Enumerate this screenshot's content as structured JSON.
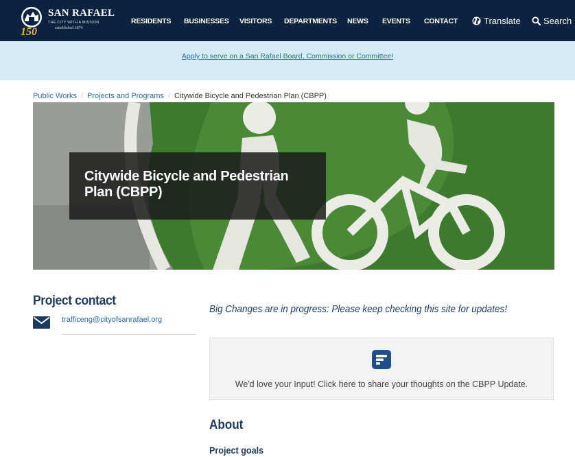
{
  "header": {
    "logo": {
      "name": "SAN RAFAEL",
      "tagline": "THE CITY WITH A MISSION",
      "established": "established 1874",
      "badge": "150"
    },
    "nav": [
      {
        "label": "RESIDENTS"
      },
      {
        "label": "BUSINESSES"
      },
      {
        "label": "VISITORS"
      },
      {
        "label": "DEPARTMENTS"
      },
      {
        "label": "NEWS"
      },
      {
        "label": "EVENTS"
      },
      {
        "label": "CONTACT"
      }
    ],
    "translate_label": "Translate",
    "translate_icon": "globe-icon",
    "search_label": "Search",
    "search_icon": "search-icon"
  },
  "notice": {
    "link_text": "Apply to serve on a San Rafael Board, Commission or Committee!"
  },
  "breadcrumb": {
    "items": [
      "Public Works",
      "Projects and Programs"
    ],
    "current": "Citywide Bicycle and Pedestrian Plan (CBPP)"
  },
  "hero": {
    "title": "Citywide Bicycle and Pedestrian Plan (CBPP)",
    "image": "painted pedestrian and bicycle symbols on green lane"
  },
  "contact": {
    "heading": "Project contact",
    "email": "trafficeng@cityofsanrafael.org",
    "email_icon": "envelope-icon"
  },
  "main": {
    "tagline": "Big Changes are in progress: Please keep checking this site for updates!",
    "cta": {
      "icon": "form-icon",
      "text": "We'd love your Input! Click here to share your thoughts on the CBPP Update."
    },
    "about_heading": "About",
    "goals_heading": "Project goals"
  },
  "colors": {
    "nav_bg": "#0c2340",
    "notice_bg": "#d5ecf7",
    "link": "#2a6aa8",
    "heading": "#1d3b5e",
    "accent_icon": "#1f4f88"
  }
}
